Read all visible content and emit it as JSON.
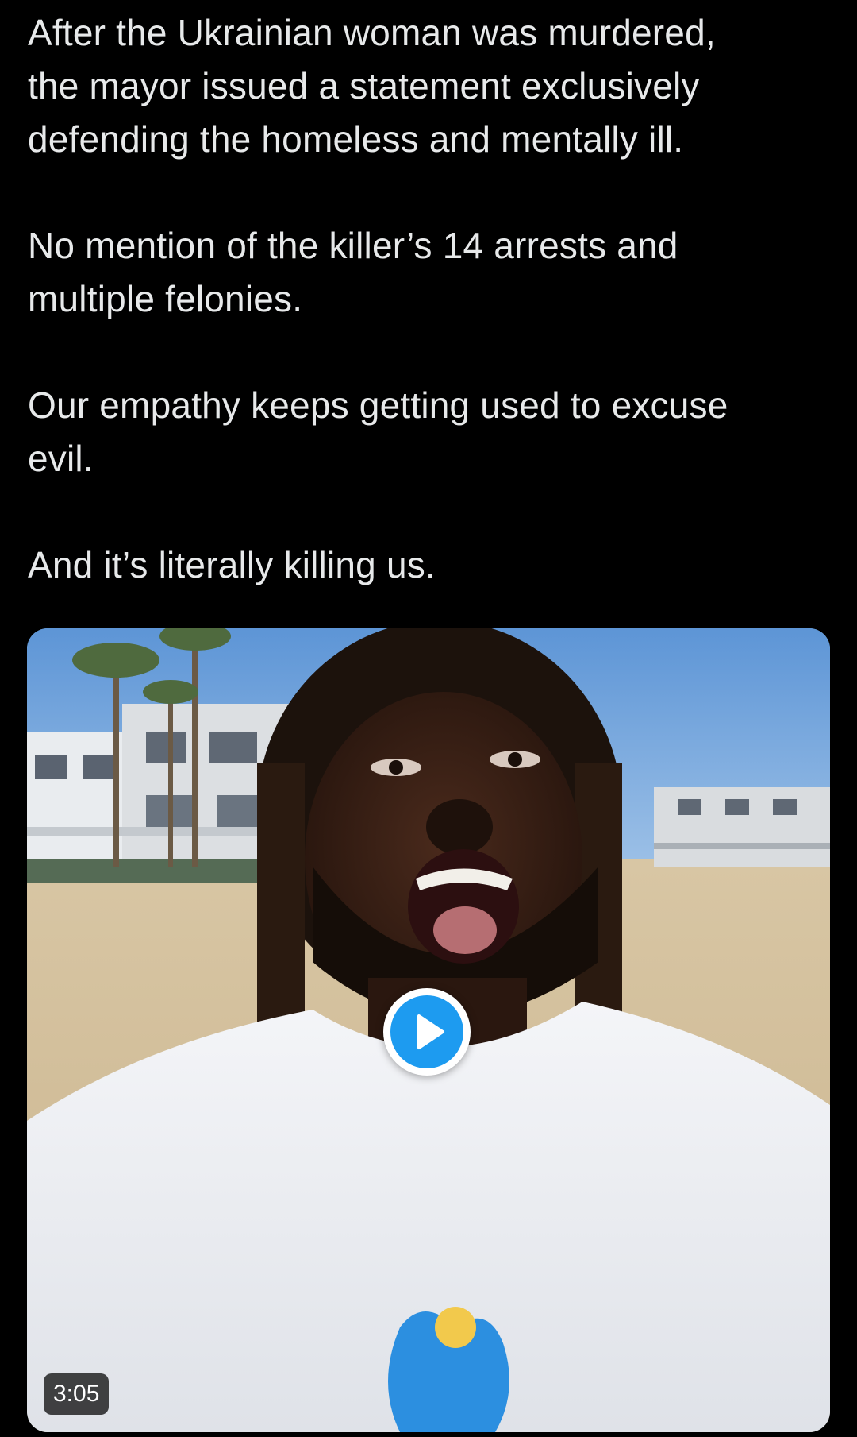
{
  "tweet": {
    "paragraphs": [
      "After the Ukrainian woman was murdered,\nthe mayor issued a statement exclusively\ndefending the homeless and mentally ill.",
      "No mention of the killer’s 14 arrests and\nmultiple felonies.",
      "Our empathy keeps getting used to excuse\nevil.",
      "And it’s literally killing us."
    ]
  },
  "media": {
    "type": "video",
    "duration": "3:05",
    "play_icon": "play-icon",
    "accent_color": "#1d9bf0"
  },
  "colors": {
    "background": "#000000",
    "text": "#e7e9ea",
    "play_button": "#1d9bf0"
  }
}
